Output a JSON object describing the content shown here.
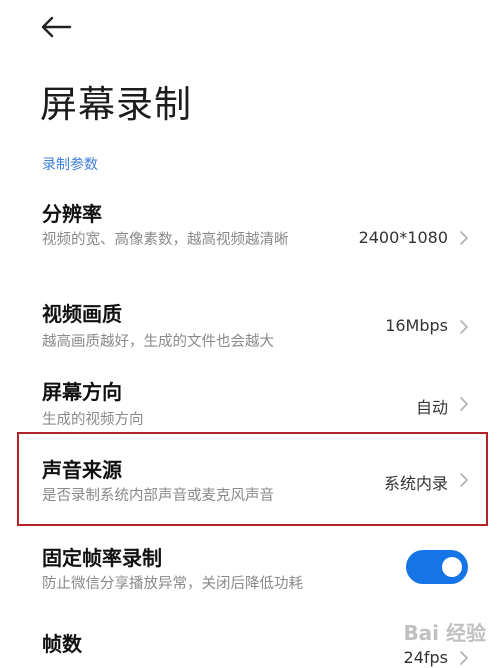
{
  "header": {
    "title": "屏幕录制"
  },
  "section": {
    "label": "录制参数"
  },
  "items": [
    {
      "title": "分辨率",
      "subtitle": "视频的宽、高像素数，越高视频越清晰",
      "value": "2400*1080"
    },
    {
      "title": "视频画质",
      "subtitle": "越高画质越好，生成的文件也会越大",
      "value": "16Mbps"
    },
    {
      "title": "屏幕方向",
      "subtitle": "生成的视频方向",
      "value": "自动"
    },
    {
      "title": "声音来源",
      "subtitle": "是否录制系统内部声音或麦克风声音",
      "value": "系统内录"
    },
    {
      "title": "固定帧率录制",
      "subtitle": "防止微信分享播放异常，关闭后降低功耗",
      "toggle_on": true
    },
    {
      "title": "帧数",
      "value": "24fps"
    }
  ],
  "watermark": "Bai 经验",
  "colors": {
    "accent": "#1574e6",
    "section_header": "#3f7fd9",
    "highlight_border": "#b3242a"
  }
}
